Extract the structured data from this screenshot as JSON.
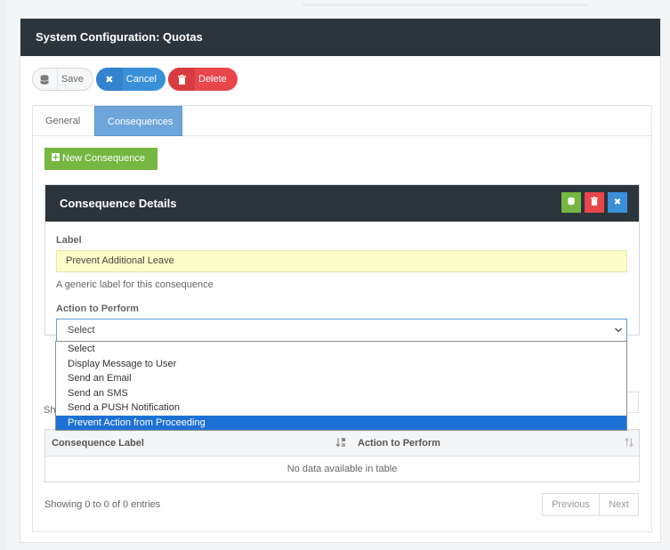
{
  "panel": {
    "title": "System Configuration: Quotas"
  },
  "toolbar": {
    "save_label": "Save",
    "cancel_label": "Cancel",
    "delete_label": "Delete"
  },
  "tabs": [
    {
      "label": "General"
    },
    {
      "label": "Consequences"
    }
  ],
  "new_button_label": "New Consequence",
  "details": {
    "title": "Consequence Details",
    "label_field": {
      "label": "Label",
      "value": "Prevent Additional Leave",
      "help": "A generic label for this consequence"
    },
    "action_field": {
      "label": "Action to Perform",
      "value": "Select"
    }
  },
  "dropdown": {
    "options": [
      "Select",
      "Display Message to User",
      "Send an Email",
      "Send an SMS",
      "Send a PUSH Notification",
      "Prevent Action from Proceeding"
    ],
    "highlighted": "Prevent Action from Proceeding"
  },
  "behind_text": "Sh",
  "table": {
    "columns": [
      "Consequence Label",
      "Action to Perform"
    ],
    "empty_text": "No data available in table",
    "info": "Showing 0 to 0 of 0 entries"
  },
  "pagination": {
    "previous": "Previous",
    "next": "Next"
  },
  "colors": {
    "header_dark": "#2d353c",
    "primary": "#3a8fd9",
    "danger": "#e8464b",
    "success": "#75b741",
    "highlight": "#1e71d4"
  }
}
